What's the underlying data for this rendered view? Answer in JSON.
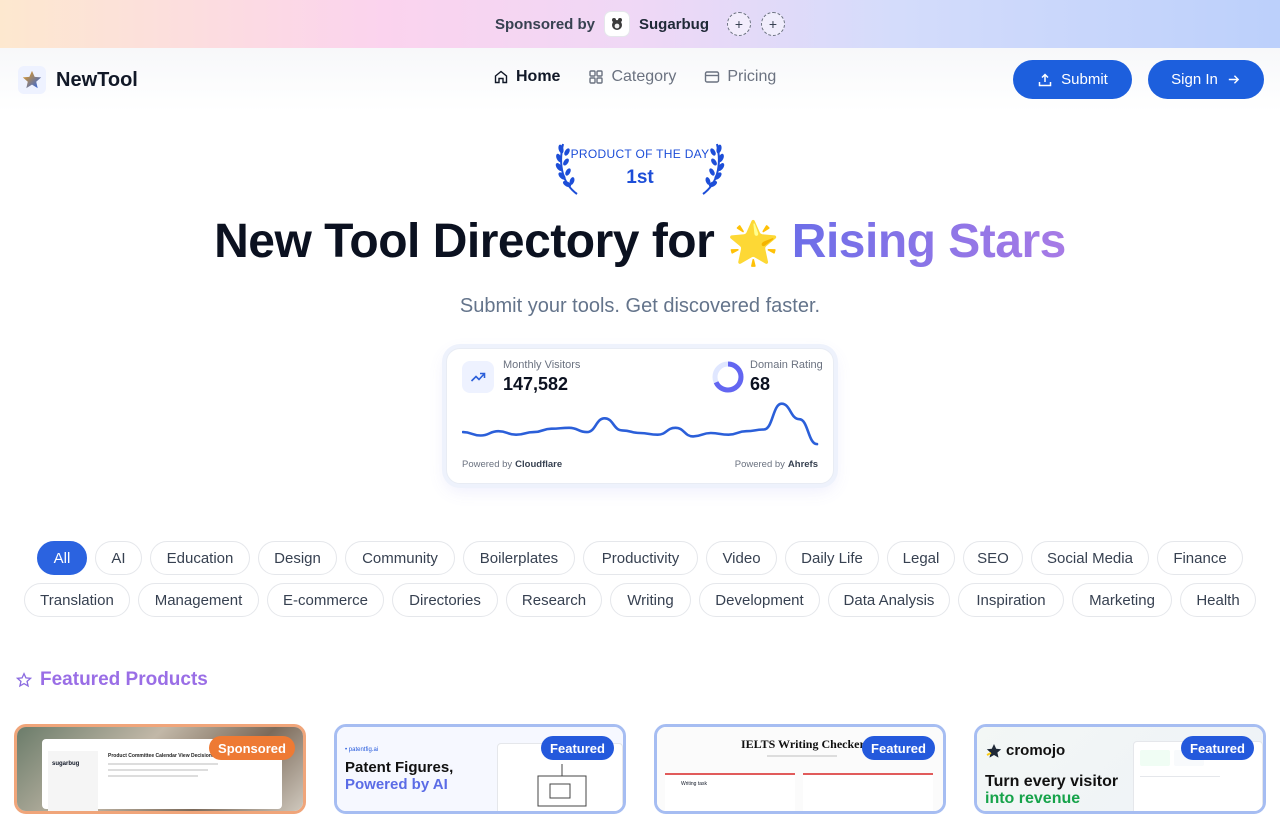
{
  "sponsor_bar": {
    "label": "Sponsored by",
    "sponsor_name": "Sugarbug",
    "slots": [
      "+",
      "+"
    ]
  },
  "header": {
    "brand": "NewTool",
    "nav": [
      {
        "label": "Home",
        "icon": "home-icon",
        "active": true
      },
      {
        "label": "Category",
        "icon": "grid-icon",
        "active": false
      },
      {
        "label": "Pricing",
        "icon": "card-icon",
        "active": false
      }
    ],
    "submit_label": "Submit",
    "signin_label": "Sign In"
  },
  "award": {
    "title": "PRODUCT OF THE DAY",
    "rank": "1st"
  },
  "hero": {
    "title_main": "New Tool Directory for",
    "title_emoji": "🌟",
    "title_highlight": "Rising Stars",
    "subtitle": "Submit your tools. Get discovered faster."
  },
  "stats": {
    "visitors_label": "Monthly Visitors",
    "visitors_value": "147,582",
    "dr_label": "Domain Rating",
    "dr_value": "68",
    "dr_fraction": 0.68,
    "powered_left_prefix": "Powered by",
    "powered_left_brand": "Cloudflare",
    "powered_right_prefix": "Powered by",
    "powered_right_brand": "Ahrefs",
    "sparkline": [
      0.3,
      0.22,
      0.32,
      0.24,
      0.3,
      0.38,
      0.4,
      0.3,
      0.62,
      0.34,
      0.28,
      0.24,
      0.4,
      0.2,
      0.28,
      0.24,
      0.32,
      0.36,
      0.96,
      0.6,
      0.02
    ],
    "accent": "#2b5fd9"
  },
  "categories_row1": [
    "All",
    "AI",
    "Education",
    "Design",
    "Community",
    "Boilerplates",
    "Productivity",
    "Video",
    "Daily Life",
    "Legal",
    "SEO",
    "Social Media",
    "Finance"
  ],
  "categories_row2": [
    "Translation",
    "Management",
    "E-commerce",
    "Directories",
    "Research",
    "Writing",
    "Development",
    "Data Analysis",
    "Inspiration",
    "Marketing",
    "Health"
  ],
  "featured": {
    "title": "Featured Products",
    "cards": [
      {
        "badge": "Sponsored",
        "preview_title": "Product Committee Calendar View Decisions",
        "logo_text": "sugarbug"
      },
      {
        "badge": "Featured",
        "preview_small": "• patentfig.ai",
        "preview_title_1": "Patent Figures,",
        "preview_title_2": "Powered by AI"
      },
      {
        "badge": "Featured",
        "preview_title": "IELTS Writing Checker",
        "preview_small": "Writing task"
      },
      {
        "badge": "Featured",
        "logo_text": "cromojo",
        "preview_title_1": "Turn every visitor",
        "preview_title_2": "into revenue"
      }
    ]
  }
}
